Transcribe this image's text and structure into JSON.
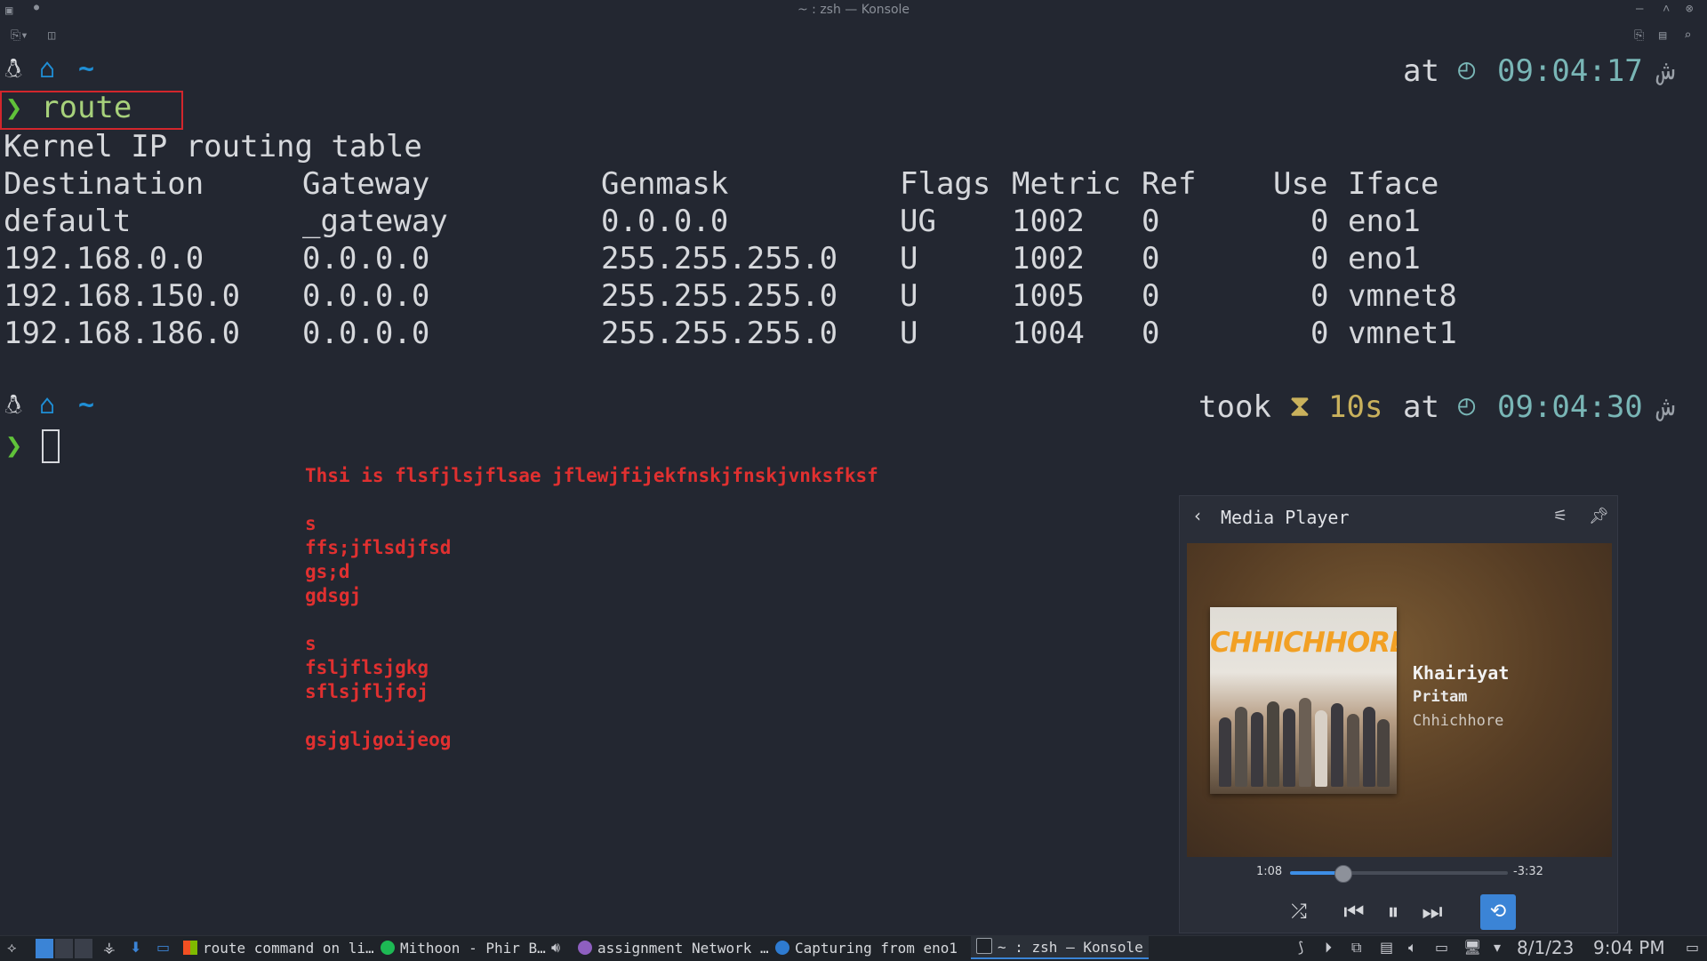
{
  "window": {
    "title": "~ : zsh — Konsole"
  },
  "terminal": {
    "prompt1": {
      "dir": "~",
      "at": "at",
      "time": "09:04:17",
      "suffix": "ش"
    },
    "command": "route",
    "output_title": "Kernel IP routing table",
    "headers": [
      "Destination",
      "Gateway",
      "Genmask",
      "Flags",
      "Metric",
      "Ref",
      "Use",
      "Iface"
    ],
    "rows": [
      [
        "default",
        "_gateway",
        "0.0.0.0",
        "UG",
        "1002",
        "0",
        "0",
        "eno1"
      ],
      [
        "192.168.0.0",
        "0.0.0.0",
        "255.255.255.0",
        "U",
        "1002",
        "0",
        "0",
        "eno1"
      ],
      [
        "192.168.150.0",
        "0.0.0.0",
        "255.255.255.0",
        "U",
        "1005",
        "0",
        "0",
        "vmnet8"
      ],
      [
        "192.168.186.0",
        "0.0.0.0",
        "255.255.255.0",
        "U",
        "1004",
        "0",
        "0",
        "vmnet1"
      ]
    ],
    "prompt2": {
      "dir": "~",
      "took": "took",
      "duration": "10s",
      "at": "at",
      "time": "09:04:30",
      "suffix": "ش"
    }
  },
  "annotation_lines": [
    "Thsi is flsfjlsjflsae jflewjfijekfnskjfnskjvnksfksf",
    "",
    "s",
    "ffs;jflsdjfsd",
    "gs;d",
    "gdsgj",
    "",
    "s",
    "fsljflsjgkg",
    "sflsjfljfoj",
    "",
    "gsjgljgoijeog"
  ],
  "media_player": {
    "header": "Media Player",
    "cover_text": "CHHICHHORE",
    "track_title": "Khairiyat",
    "artist": "Pritam",
    "album": "Chhichhore",
    "elapsed": "1:08",
    "remaining": "-3:32",
    "progress_fraction": 0.24,
    "accent": "#3b84d6"
  },
  "taskbar": {
    "tasks": [
      {
        "label": "route command on li…",
        "icon": "windows-icon"
      },
      {
        "label": "Mithoon - Phir B…",
        "icon": "spotify-icon"
      },
      {
        "label": "assignment Network …",
        "icon": "browser-icon"
      },
      {
        "label": "Capturing from eno1",
        "icon": "wireshark-icon"
      },
      {
        "label": "~ : zsh — Konsole",
        "icon": "terminal-icon"
      }
    ],
    "date": "8/1/23",
    "clock": "9:04 PM"
  },
  "colors": {
    "background": "#232731",
    "prompt_green": "#60c23a",
    "time_teal": "#79b6b6",
    "annotation_red": "#e03030",
    "highlight_box": "#d3262c"
  }
}
